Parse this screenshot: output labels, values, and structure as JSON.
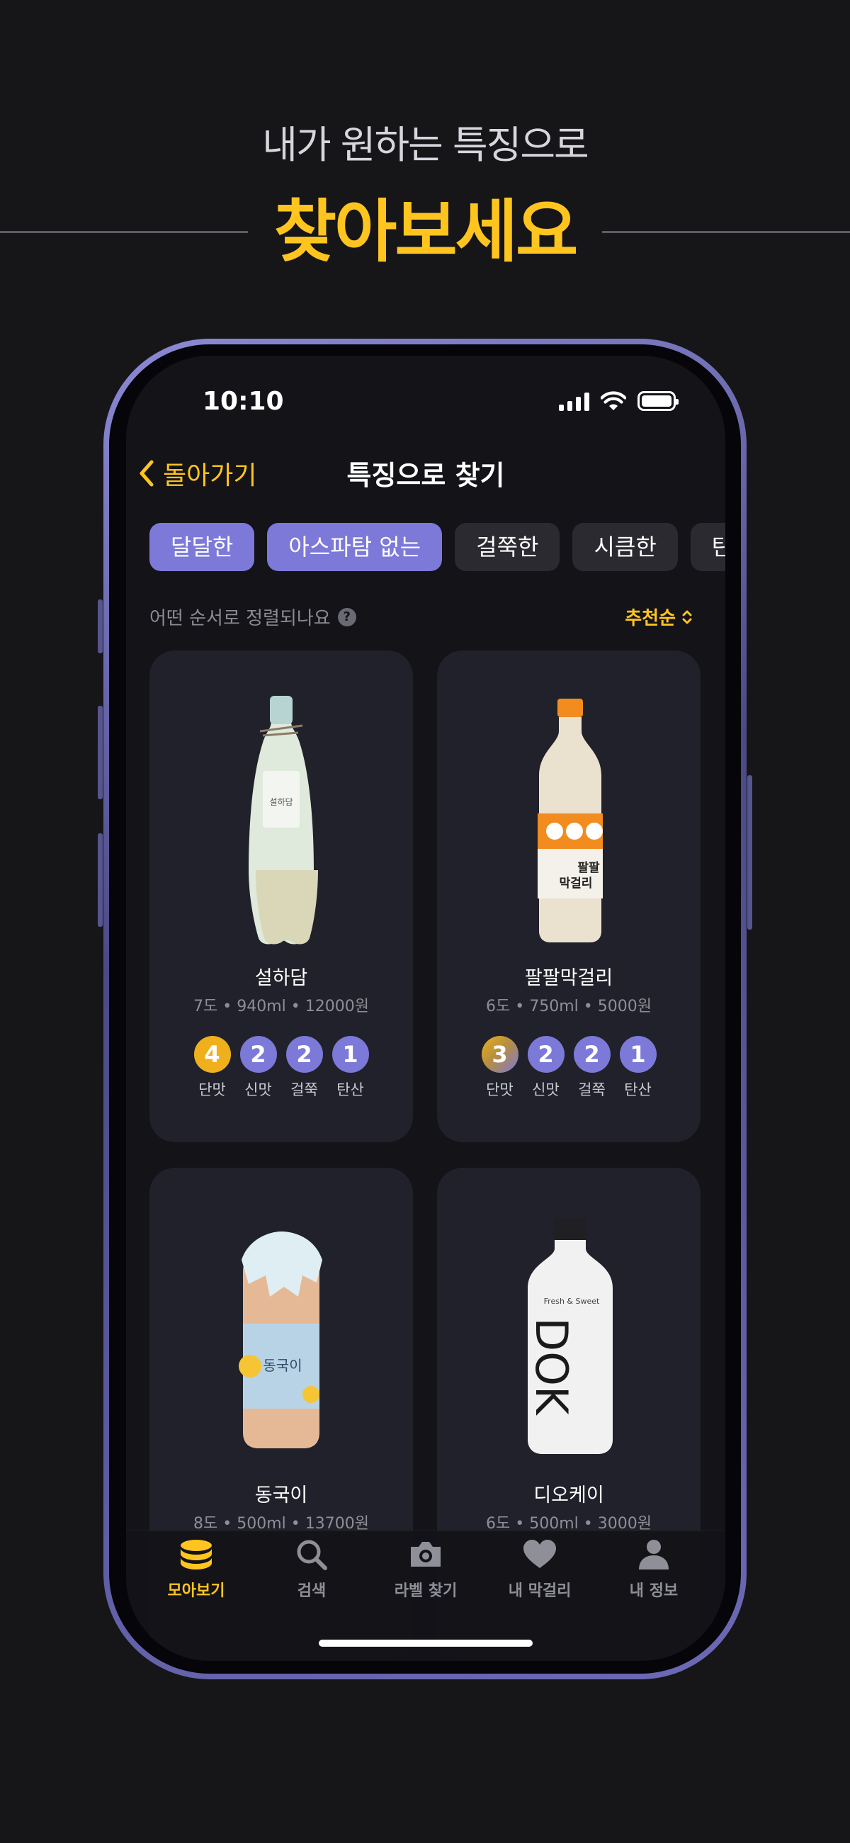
{
  "promo": {
    "subtitle": "내가 원하는 특징으로",
    "headline": "찾아보세요"
  },
  "status_bar": {
    "time": "10:10",
    "icons": [
      "cellular-signal-icon",
      "wifi-icon",
      "battery-icon"
    ]
  },
  "nav": {
    "back_label": "돌아가기",
    "title": "특징으로 찾기"
  },
  "filters": [
    {
      "label": "달달한",
      "active": true
    },
    {
      "label": "아스파탐 없는",
      "active": true
    },
    {
      "label": "걸쭉한",
      "active": false
    },
    {
      "label": "시큼한",
      "active": false
    },
    {
      "label": "탄",
      "active": false
    }
  ],
  "sort": {
    "question": "어떤 순서로 정렬되나요",
    "help_glyph": "?",
    "selected": "추천순"
  },
  "products": [
    {
      "name": "설하담",
      "meta": "7도 • 940ml • 12000원",
      "scores": [
        {
          "value": "4",
          "label": "단맛"
        },
        {
          "value": "2",
          "label": "신맛"
        },
        {
          "value": "2",
          "label": "걸쭉"
        },
        {
          "value": "1",
          "label": "탄산"
        }
      ]
    },
    {
      "name": "팔팔막걸리",
      "meta": "6도 • 750ml • 5000원",
      "scores": [
        {
          "value": "3",
          "label": "단맛"
        },
        {
          "value": "2",
          "label": "신맛"
        },
        {
          "value": "2",
          "label": "걸쭉"
        },
        {
          "value": "1",
          "label": "탄산"
        }
      ]
    },
    {
      "name": "동국이",
      "meta": "8도 • 500ml • 13700원"
    },
    {
      "name": "디오케이",
      "meta": "6도 • 500ml • 3000원"
    }
  ],
  "bottle_labels": {
    "b1": "설하담",
    "b2_top": "팔팔",
    "b2_bottom": "막걸리",
    "b3": "동국이",
    "b4": "DOK"
  },
  "tabs": [
    {
      "label": "모아보기",
      "icon": "coin-stack-icon",
      "active": true
    },
    {
      "label": "검색",
      "icon": "search-icon",
      "active": false
    },
    {
      "label": "라벨 찾기",
      "icon": "camera-icon",
      "active": false
    },
    {
      "label": "내 막걸리",
      "icon": "heart-icon",
      "active": false
    },
    {
      "label": "내 정보",
      "icon": "person-icon",
      "active": false
    }
  ],
  "colors": {
    "accent_yellow": "#ffc51e",
    "accent_purple": "#7c79d9",
    "background": "#161619",
    "card": "#20212a"
  }
}
